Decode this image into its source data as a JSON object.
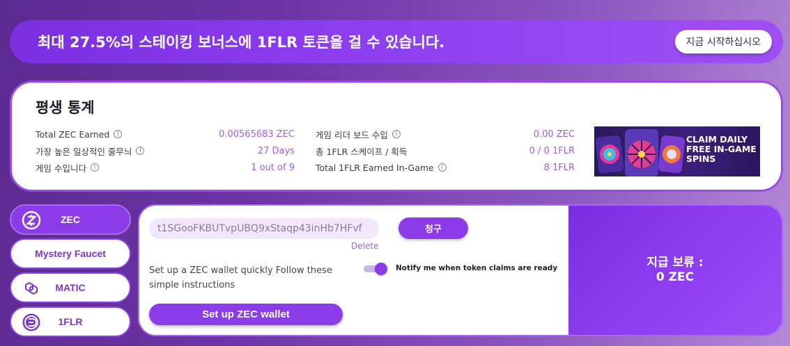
{
  "banner": {
    "text": "최대 27.5%의 스테이킹 보너스에 1FLR 토큰을 걸 수 있습니다.",
    "button_label": "지금 시작하십시오"
  },
  "stats": {
    "title": "평생 통계",
    "left": [
      {
        "label": "Total ZEC Earned",
        "value": "0.00565683 ZEC"
      },
      {
        "label": "가장 높은 일상적인 줄무늬",
        "value": "27 Days"
      },
      {
        "label": "게임 수입니다",
        "value": "1 out of 9"
      }
    ],
    "right": [
      {
        "label": "게임 리더 보드 수입",
        "value": "0.00 ZEC"
      },
      {
        "label": "총 1FLR 스케이프 / 획득",
        "value": "0 / 0 1FLR"
      },
      {
        "label": "Total 1FLR Earned In-Game",
        "value": "8 1FLR"
      }
    ],
    "info_icon": "i"
  },
  "promo": {
    "line1": "CLAIM DAILY",
    "line2": "FREE IN-GAME",
    "line3": "SPINS"
  },
  "sidebar": {
    "items": [
      {
        "label": "ZEC",
        "icon": "zcash-icon",
        "active": true
      },
      {
        "label": "Mystery Faucet",
        "icon": "",
        "active": false
      },
      {
        "label": "MATIC",
        "icon": "polygon-icon",
        "active": false
      },
      {
        "label": "1FLR",
        "icon": "flare-icon",
        "active": false
      }
    ]
  },
  "faucet": {
    "address_value": "t1SGooFKBUTvpUBQ9xStaqp43inHb7HFvf",
    "claim_label": "청구",
    "delete_label": "Delete",
    "setup_text": "Set up a ZEC wallet quickly Follow these simple instructions",
    "notify_text": "Notify me when token claims are ready",
    "notify_on": true,
    "wallet_button_label": "Set up ZEC wallet",
    "pending_label": "지급 보류 :",
    "pending_value": "0 ZEC"
  },
  "colors": {
    "accent": "#8b3ce8",
    "value_text": "#a060e0"
  }
}
